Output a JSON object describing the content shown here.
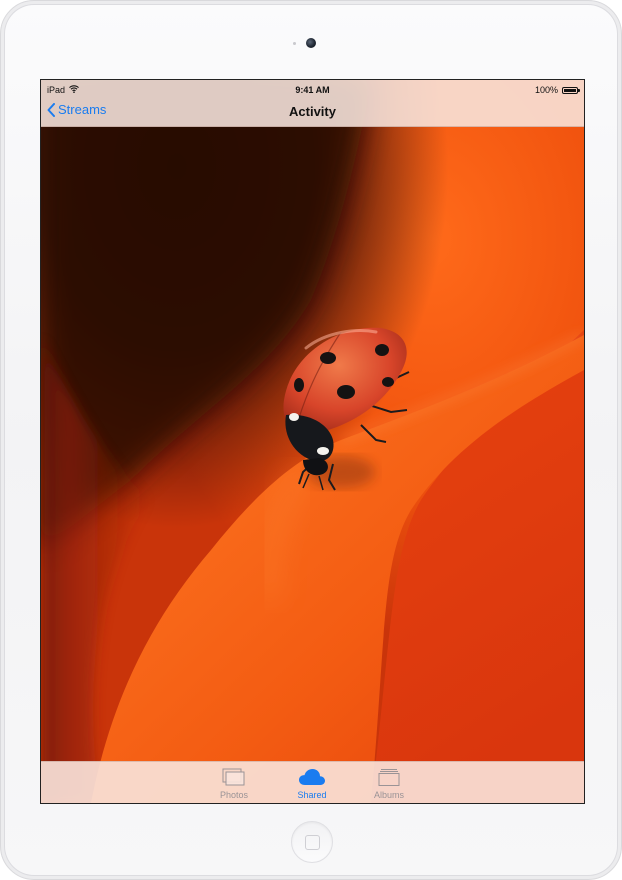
{
  "status_bar": {
    "device": "iPad",
    "time": "9:41 AM",
    "battery": "100%",
    "battery_level": 1.0
  },
  "nav": {
    "back_label": "Streams",
    "title": "Activity"
  },
  "tabs": [
    {
      "label": "Photos",
      "icon": "photos-icon",
      "active": false
    },
    {
      "label": "Shared",
      "icon": "cloud-icon",
      "active": true
    },
    {
      "label": "Albums",
      "icon": "albums-icon",
      "active": false
    }
  ],
  "colors": {
    "accent": "#1a7cf0",
    "tab_inactive": "#9a9396"
  },
  "content": {
    "image": "ladybug-on-orange-petal"
  }
}
